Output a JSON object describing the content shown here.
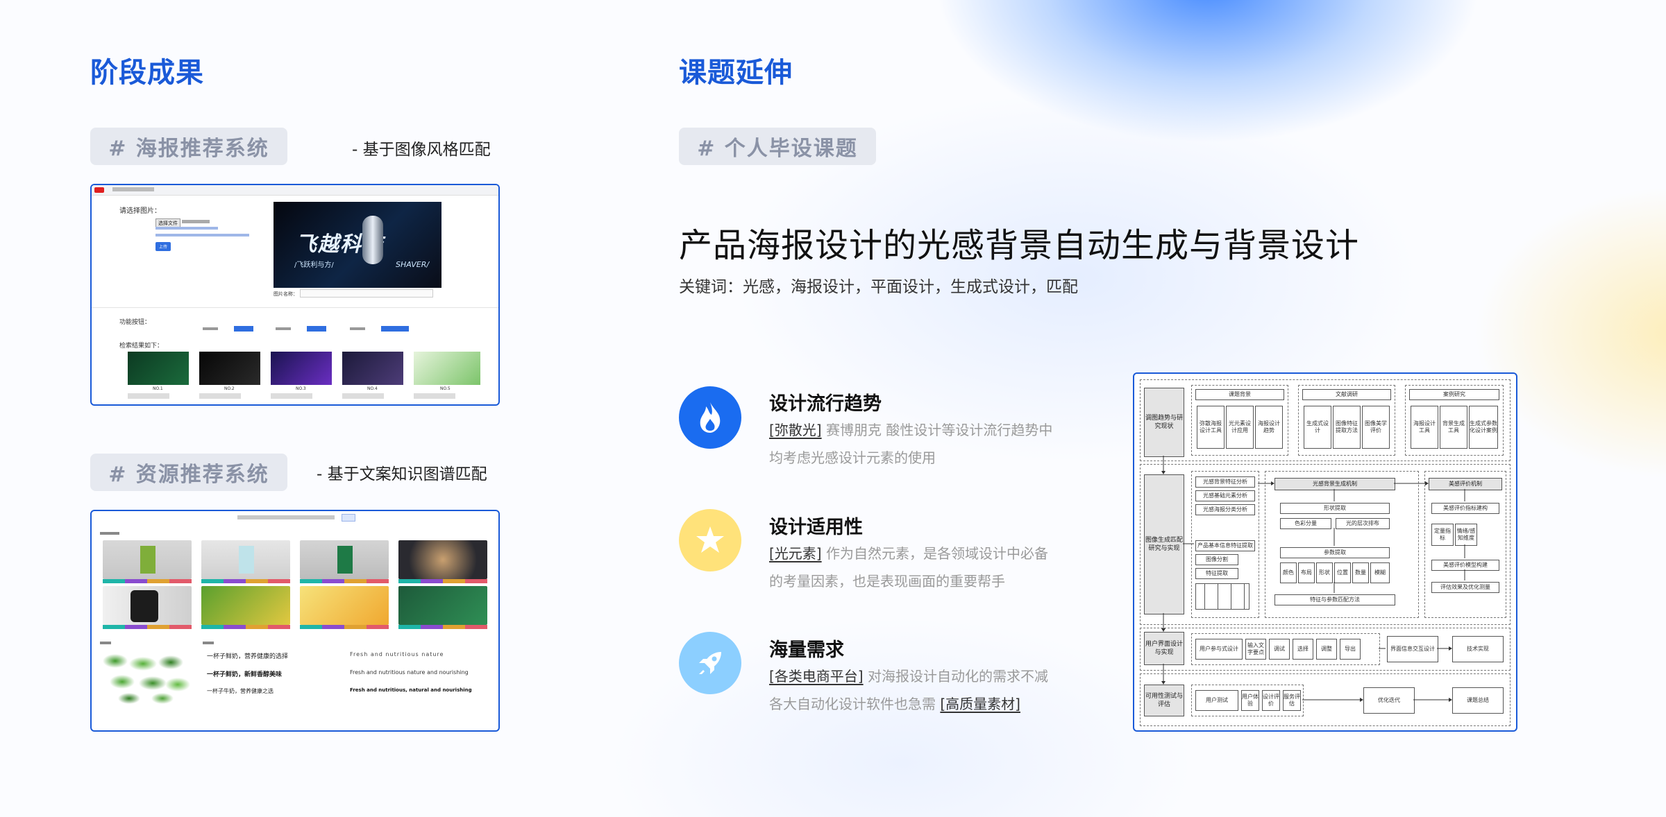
{
  "left": {
    "heading": "阶段成果",
    "poster_tag": "# 海报推荐系统",
    "poster_sub": "- 基于图像风格匹配",
    "resource_tag": "# 资源推荐系统",
    "resource_sub": "- 基于文案知识图谱匹配",
    "poster_shot": {
      "select_label": "请选择图片：",
      "choose_btn": "选择文件",
      "upload_btn": "上传",
      "banner_big": "飞越科技",
      "banner_small": "/飞跃利与方/",
      "banner_shaver": "SHAVER/",
      "image_name_label": "图片名称：",
      "func_label": "功能按钮：",
      "results_label": "检索结果如下：",
      "result_nos": [
        "NO.1",
        "NO.2",
        "NO.3",
        "NO.4",
        "NO.5"
      ]
    },
    "resource_shot": {
      "copy_left_1": "一杯子鲜奶，营养健康的选择",
      "copy_left_2": "一杯子鲜奶，新鲜香醇美味",
      "copy_left_3": "一杯子牛奶，营养健康之选",
      "copy_right_1": "Fresh and nutritious nature",
      "copy_right_2": "Fresh and nutritious nature and nourishing",
      "copy_right_3": "Fresh and nutritious, natural and nourishing"
    }
  },
  "right": {
    "heading": "课题延伸",
    "tag": "# 个人毕设课题",
    "title": "产品海报设计的光感背景自动生成与背景设计",
    "keywords": "关键词：光感，海报设计，平面设计，生成式设计，匹配",
    "features": [
      {
        "title": "设计流行趋势",
        "hl1": "[弥散光]",
        "desc1": " 赛博朋克 酸性设计等设计流行趋势中",
        "desc2": "均考虑光感设计元素的使用",
        "icon": "flame-icon",
        "color": "#1a6cf0"
      },
      {
        "title": "设计适用性",
        "hl1": "[光元素]",
        "desc1": " 作为自然元素，是各领域设计中必备",
        "desc2": "的考量因素，也是表现画面的重要帮手",
        "icon": "star-icon",
        "color": "#ffe27a"
      },
      {
        "title": "海量需求",
        "hl1": "[各类电商平台]",
        "desc1": " 对海报设计自动化的需求不减",
        "desc2": "各大自动化设计软件也急需 ",
        "hl2": "[高质量素材]",
        "icon": "rocket-icon",
        "color": "#8ccfff"
      }
    ],
    "flowchart": {
      "sec1": "调图趋势与研究现状",
      "sec2": "图像生成匹配研究与实现",
      "sec3": "用户界面设计与实现",
      "sec4": "可用性测试与评估",
      "top_heads": [
        "课题背景",
        "文献调研",
        "案例研究"
      ],
      "top_items": [
        "弥散海报设计工具",
        "光元素设计应用",
        "海报设计趋势",
        "生成式设计",
        "图像特征提取方法",
        "图像美学评价",
        "海报设计工具",
        "背景生成工具",
        "生成式参数化设计案例"
      ],
      "mid_left": [
        "光感背景特征分析",
        "光感基础元素分析",
        "光感海报分类分析",
        "产品基本信息特征提取",
        "图像分割",
        "特征提取"
      ],
      "mid_center_head": "光感背景生成机制",
      "mid_center": [
        "形状提取",
        "色彩分量",
        "光的层次排布",
        "参数提取",
        "特征与参数匹配方法"
      ],
      "mid_center_row": [
        "颜色",
        "布局",
        "形状",
        "位置",
        "数量",
        "模糊"
      ],
      "mid_right_head": "美感评价机制",
      "mid_right": [
        "美感评价指标建构",
        "定量指标",
        "情绪/感知维度",
        "美感评价模型构建",
        "评估效果及优化测量"
      ],
      "ui_row": [
        "用户参与式设计",
        "输入文字要点",
        "调试",
        "选择",
        "调整",
        "导出"
      ],
      "ui_right": [
        "界面信息交互设计",
        "技术实现"
      ],
      "test_row": [
        "用户测试",
        "用户体验",
        "设计评价",
        "服务评估"
      ],
      "test_right": [
        "优化迭代",
        "课题总结"
      ]
    }
  }
}
